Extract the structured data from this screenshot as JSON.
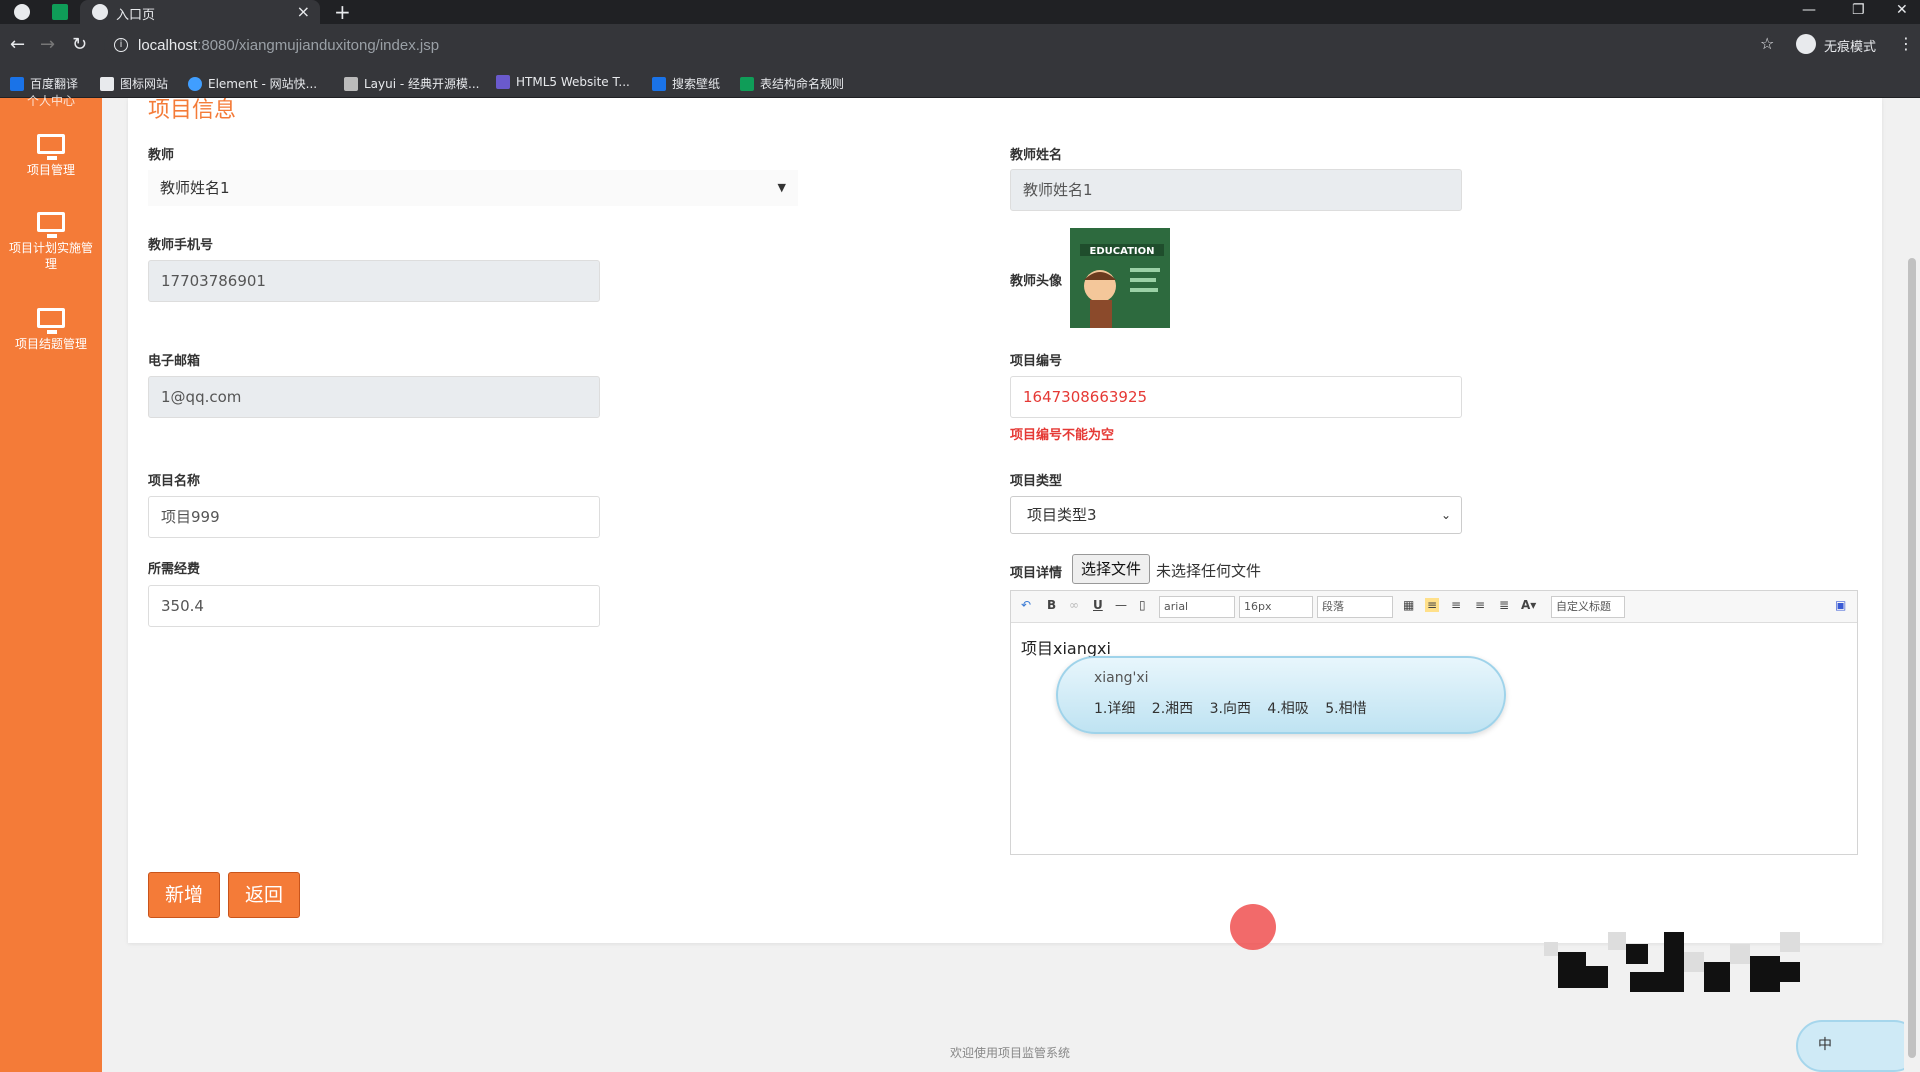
{
  "browser": {
    "tab_title": "入口页",
    "url_host": "localhost",
    "url_rest": ":8080/xiangmujianduxitong/index.jsp",
    "incognito_label": "无痕模式",
    "bookmarks": [
      "百度翻译",
      "图标网站",
      "Element - 网站快...",
      "Layui - 经典开源模...",
      "HTML5 Website T...",
      "搜索壁纸",
      "表结构命名规则"
    ]
  },
  "sidebar": {
    "top_partial": "个人中心",
    "items": [
      {
        "label": "项目管理"
      },
      {
        "label": "项目计划实施管理"
      },
      {
        "label": "项目结题管理"
      }
    ]
  },
  "form": {
    "section_title": "项目信息",
    "teacher_label": "教师",
    "teacher_value": "教师姓名1",
    "teacher_name_label": "教师姓名",
    "teacher_name_value": "教师姓名1",
    "phone_label": "教师手机号",
    "phone_value": "17703786901",
    "avatar_label": "教师头像",
    "email_label": "电子邮箱",
    "email_value": "1@qq.com",
    "project_no_label": "项目编号",
    "project_no_value": "1647308663925",
    "project_no_error": "项目编号不能为空",
    "project_name_label": "项目名称",
    "project_name_value": "项目999",
    "project_type_label": "项目类型",
    "project_type_value": "项目类型3",
    "budget_label": "所需经费",
    "budget_value": "350.4",
    "detail_label": "项目详情",
    "file_button": "选择文件",
    "file_status": "未选择任何文件",
    "editor": {
      "font": "arial",
      "size": "16px",
      "paragraph": "段落",
      "custom_title": "自定义标题",
      "content": "项目xiangxi"
    },
    "ime": {
      "pinyin": "xiang'xi",
      "candidates": "1.详细 2.湘西 3.向西 4.相吸 5.相惜"
    },
    "add_button": "新增",
    "back_button": "返回"
  },
  "footer": "欢迎使用项目监管系统",
  "ime_bubble_label": "中"
}
